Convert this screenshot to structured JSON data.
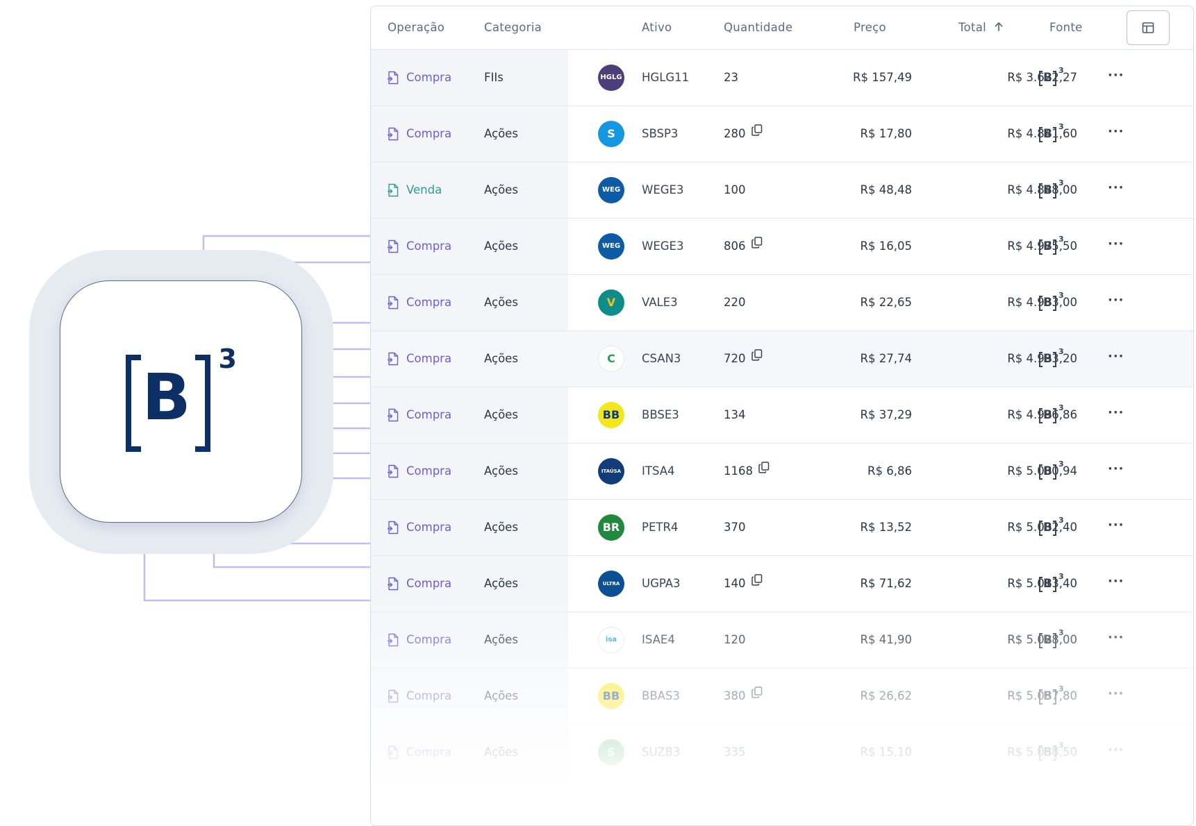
{
  "brand": {
    "name": "B3",
    "letter": "B",
    "superscript": "3",
    "color": "#0c2f66"
  },
  "colors": {
    "accent_compra": "#6b5fd3",
    "accent_venda": "#2e9d8f",
    "connector": "#c3bcf2",
    "halo": "#e6ebf2"
  },
  "table": {
    "headers": {
      "operacao": "Operação",
      "categoria": "Categoria",
      "ativo": "Ativo",
      "quantidade": "Quantidade",
      "preco": "Preço",
      "total": "Total",
      "fonte": "Fonte"
    },
    "sort": {
      "column": "total",
      "direction": "ascending",
      "icon": "arrow-up-icon"
    },
    "columns_button_icon": "table-columns-icon",
    "rows": [
      {
        "op": "Compra",
        "cat": "FIIs",
        "ticker": "HGLG11",
        "qty": "23",
        "copy": false,
        "price": "R$ 157,49",
        "total": "R$ 3.622,27",
        "logo_text": "HGLG",
        "logo_bg": "#4a3f78",
        "logo_fg": "#ffffff"
      },
      {
        "op": "Compra",
        "cat": "Ações",
        "ticker": "SBSP3",
        "qty": "280",
        "copy": true,
        "price": "R$ 17,80",
        "total": "R$ 4.841,60",
        "logo_text": "S",
        "logo_bg": "#1596e0",
        "logo_fg": "#ffffff"
      },
      {
        "op": "Venda",
        "cat": "Ações",
        "ticker": "WEGE3",
        "qty": "100",
        "copy": false,
        "price": "R$ 48,48",
        "total": "R$ 4.848,00",
        "logo_text": "WEG",
        "logo_bg": "#0d5aa7",
        "logo_fg": "#ffffff"
      },
      {
        "op": "Compra",
        "cat": "Ações",
        "ticker": "WEGE3",
        "qty": "806",
        "copy": true,
        "price": "R$ 16,05",
        "total": "R$ 4.975,50",
        "logo_text": "WEG",
        "logo_bg": "#0d5aa7",
        "logo_fg": "#ffffff"
      },
      {
        "op": "Compra",
        "cat": "Ações",
        "ticker": "VALE3",
        "qty": "220",
        "copy": false,
        "price": "R$ 22,65",
        "total": "R$ 4.983,00",
        "logo_text": "V",
        "logo_bg": "#0e8c8c",
        "logo_fg": "#f0c419"
      },
      {
        "op": "Compra",
        "cat": "Ações",
        "ticker": "CSAN3",
        "qty": "720",
        "copy": true,
        "price": "R$ 27,74",
        "total": "R$ 4.993,20",
        "logo_text": "C",
        "logo_bg": "#ffffff",
        "logo_fg": "#2e9b55"
      },
      {
        "op": "Compra",
        "cat": "Ações",
        "ticker": "BBSE3",
        "qty": "134",
        "copy": false,
        "price": "R$ 37,29",
        "total": "R$ 4.996,86",
        "logo_text": "BB",
        "logo_bg": "#f5e51b",
        "logo_fg": "#0c3a8a"
      },
      {
        "op": "Compra",
        "cat": "Ações",
        "ticker": "ITSA4",
        "qty": "1168",
        "copy": true,
        "price": "R$ 6,86",
        "total": "R$ 5.000,94",
        "logo_text": "ITAÚSA",
        "logo_bg": "#103d7a",
        "logo_fg": "#ffffff"
      },
      {
        "op": "Compra",
        "cat": "Ações",
        "ticker": "PETR4",
        "qty": "370",
        "copy": false,
        "price": "R$ 13,52",
        "total": "R$ 5.002,40",
        "logo_text": "BR",
        "logo_bg": "#1f8a3e",
        "logo_fg": "#ffffff"
      },
      {
        "op": "Compra",
        "cat": "Ações",
        "ticker": "UGPA3",
        "qty": "140",
        "copy": true,
        "price": "R$ 71,62",
        "total": "R$ 5.013,40",
        "logo_text": "ULTRA",
        "logo_bg": "#0d4f94",
        "logo_fg": "#ffffff"
      },
      {
        "op": "Compra",
        "cat": "Ações",
        "ticker": "ISAE4",
        "qty": "120",
        "copy": false,
        "price": "R$ 41,90",
        "total": "R$ 5.028,00",
        "logo_text": "isa",
        "logo_bg": "#ffffff",
        "logo_fg": "#1d9ad6"
      },
      {
        "op": "Compra",
        "cat": "Ações",
        "ticker": "BBAS3",
        "qty": "380",
        "copy": true,
        "price": "R$ 26,62",
        "total": "R$ 5.057,80",
        "logo_text": "BB",
        "logo_bg": "#f5e51b",
        "logo_fg": "#0c3a8a"
      },
      {
        "op": "Compra",
        "cat": "Ações",
        "ticker": "SUZB3",
        "qty": "335",
        "copy": false,
        "price": "R$ 15,10",
        "total": "R$ 5.058,50",
        "logo_text": "S",
        "logo_bg": "#4fae6b",
        "logo_fg": "#ffffff"
      }
    ]
  }
}
